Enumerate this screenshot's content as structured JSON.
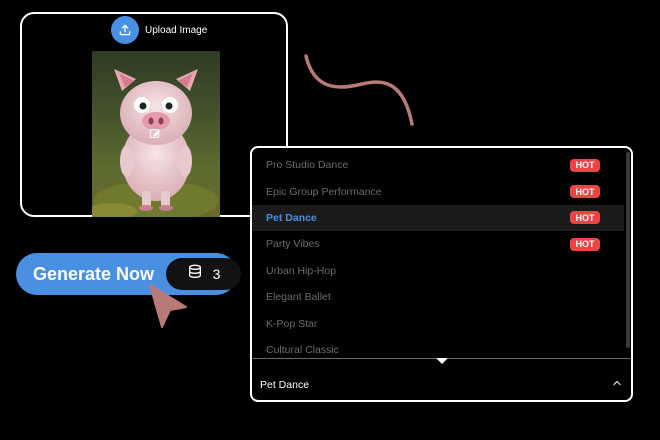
{
  "upload": {
    "label": "Upload Image",
    "icon": "upload-icon",
    "edit_icon": "edit-image-icon"
  },
  "generate": {
    "label": "Generate Now",
    "credits": "3",
    "credits_icon": "database-icon"
  },
  "dropdown": {
    "items": [
      {
        "label": "Pro Studio Dance",
        "badge": "HOT"
      },
      {
        "label": "Epic Group Performance",
        "badge": "HOT"
      },
      {
        "label": "Pet Dance",
        "badge": "HOT",
        "selected": true
      },
      {
        "label": "Party Vibes",
        "badge": "HOT"
      },
      {
        "label": "Urban Hip-Hop",
        "badge": ""
      },
      {
        "label": "Elegant Ballet",
        "badge": ""
      },
      {
        "label": "K-Pop Star",
        "badge": ""
      },
      {
        "label": "Cultural Classic",
        "badge": ""
      }
    ],
    "selected_value": "Pet Dance",
    "chevron_icon": "chevron-up-icon"
  },
  "colors": {
    "accent": "#4a90e2",
    "hot_badge": "#ef4444",
    "squiggle": "#b87a76",
    "cursor": "#b87a76"
  }
}
